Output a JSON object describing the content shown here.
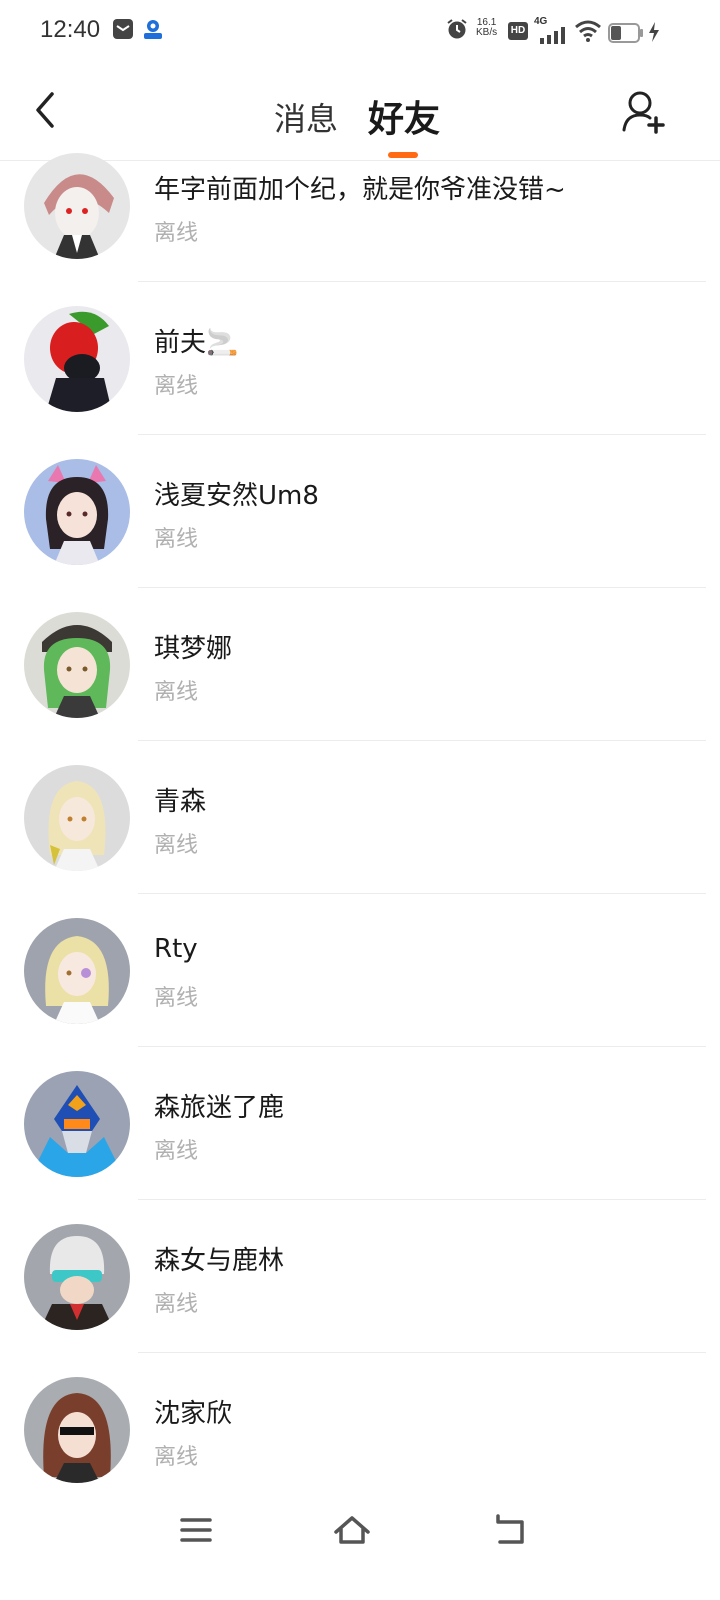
{
  "status_bar": {
    "time": "12:40",
    "network_speed_value": "16.1",
    "network_speed_unit": "KB/s",
    "hd_badge": "HD",
    "network_type": "4G",
    "icons": [
      "mail-icon",
      "app-notification-icon",
      "alarm-icon",
      "signal-icon",
      "wifi-icon",
      "battery-icon",
      "charging-icon"
    ]
  },
  "header": {
    "tabs": [
      {
        "label": "消息",
        "active": false
      },
      {
        "label": "好友",
        "active": true
      }
    ],
    "accent_color": "#ff6a13",
    "icons": [
      "back-arrow-icon",
      "add-friend-icon"
    ]
  },
  "friends": [
    {
      "name": "年字前面加个纪，就是你爷准没错~",
      "status": "离线"
    },
    {
      "name": "前夫🚬",
      "status": "离线"
    },
    {
      "name": "浅夏安然Um8",
      "status": "离线"
    },
    {
      "name": "琪梦娜",
      "status": "离线"
    },
    {
      "name": "青森",
      "status": "离线"
    },
    {
      "name": "Rty",
      "status": "离线"
    },
    {
      "name": "森旅迷了鹿",
      "status": "离线"
    },
    {
      "name": "森女与鹿林",
      "status": "离线"
    },
    {
      "name": "沈家欣",
      "status": "离线"
    }
  ],
  "nav_bar": {
    "icons": [
      "menu-icon",
      "home-icon",
      "back-icon"
    ]
  }
}
